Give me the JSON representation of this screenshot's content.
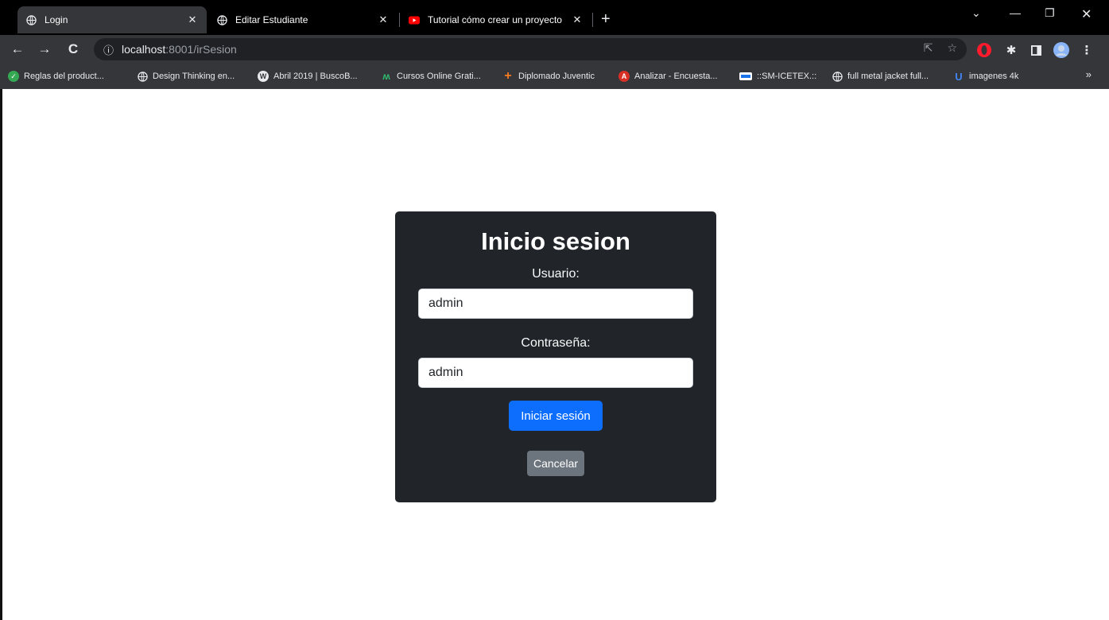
{
  "browser": {
    "tabs": [
      {
        "title": "Login",
        "active": true
      },
      {
        "title": "Editar Estudiante",
        "active": false
      },
      {
        "title": "Tutorial cómo crear un proyecto",
        "active": false
      }
    ],
    "url_host": "localhost",
    "url_path": ":8001/irSesion",
    "bookmarks": [
      {
        "label": "Reglas del product...",
        "icon": "shield-check-icon",
        "color": "#34a853"
      },
      {
        "label": "Design Thinking en...",
        "icon": "globe-icon",
        "color": "#9aa0a6"
      },
      {
        "label": "Abril 2019 | BuscoB...",
        "icon": "wordpress-icon",
        "color": "#9aa0a6"
      },
      {
        "label": "Cursos Online Grati...",
        "icon": "m-logo-icon",
        "color": "#2dbd6e"
      },
      {
        "label": "Diplomado Juventic",
        "icon": "cross-icon",
        "color": "#f47b20"
      },
      {
        "label": "Analizar - Encuesta...",
        "icon": "circle-logo-icon",
        "color": "#d93025"
      },
      {
        "label": "::SM-ICETEX.::",
        "icon": "banner-icon",
        "color": "#1a73e8"
      },
      {
        "label": "full metal jacket full...",
        "icon": "globe-icon",
        "color": "#9aa0a6"
      },
      {
        "label": "imagenes 4k",
        "icon": "u-logo-icon",
        "color": "#4285f4"
      }
    ],
    "bookmarks_more": "»"
  },
  "login": {
    "title": "Inicio sesion",
    "user_label": "Usuario:",
    "user_value": "admin",
    "password_label": "Contraseña:",
    "password_value": "admin",
    "submit_label": "Iniciar sesión",
    "cancel_label": "Cancelar"
  }
}
